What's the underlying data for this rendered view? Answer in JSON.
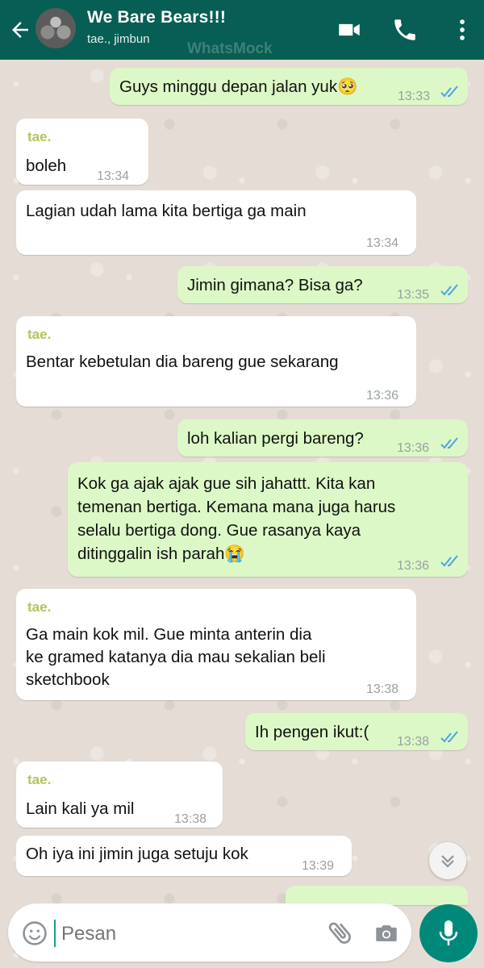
{
  "header": {
    "title": "We Bare Bears!!!",
    "subtitle": "tae., jimbun",
    "watermark": "WhatsMock",
    "icons": [
      "back-arrow-icon",
      "video-call-icon",
      "phone-icon",
      "more-vert-icon"
    ]
  },
  "messages": [
    {
      "dir": "out",
      "text": "Guys minggu depan jalan yuk🥺",
      "time": "13:33",
      "status": "read"
    },
    {
      "dir": "in",
      "sender": "tae.",
      "text": "boleh",
      "time": "13:34"
    },
    {
      "dir": "in",
      "text": "Lagian udah lama kita bertiga ga main",
      "time": "13:34"
    },
    {
      "dir": "out",
      "text": "Jimin gimana? Bisa ga?",
      "time": "13:35",
      "status": "read"
    },
    {
      "dir": "in",
      "sender": "tae.",
      "text": "Bentar kebetulan dia bareng gue sekarang",
      "time": "13:36"
    },
    {
      "dir": "out",
      "text": "loh kalian pergi bareng?",
      "time": "13:36",
      "status": "read"
    },
    {
      "dir": "out",
      "lines": [
        "Kok ga ajak ajak gue sih jahattt. Kita kan",
        "temenan bertiga. Kemana mana juga harus",
        "selalu bertiga dong. Gue rasanya kaya",
        "ditinggalin ish parah😭"
      ],
      "time": "13:36",
      "status": "read"
    },
    {
      "dir": "in",
      "sender": "tae.",
      "lines": [
        "Ga main kok mil. Gue minta anterin dia",
        "ke gramed katanya dia mau sekalian beli",
        "sketchbook"
      ],
      "time": "13:38"
    },
    {
      "dir": "out",
      "text": "Ih pengen ikut:(",
      "time": "13:38",
      "status": "read"
    },
    {
      "dir": "in",
      "sender": "tae.",
      "text": "Lain kali ya mil",
      "time": "13:38"
    },
    {
      "dir": "in",
      "text": "Oh iya ini jimin juga setuju kok",
      "time": "13:39"
    }
  ],
  "composer": {
    "placeholder": "Pesan",
    "icons": [
      "emoji-icon",
      "attach-icon",
      "camera-icon",
      "mic-icon"
    ]
  },
  "colors": {
    "header_bg": "#075e54",
    "outgoing_bubble": "#dcf8c6",
    "incoming_bubble": "#ffffff",
    "sender_name": "#b5c35a",
    "read_ticks": "#4fa3e0",
    "mic_button": "#00897b"
  }
}
